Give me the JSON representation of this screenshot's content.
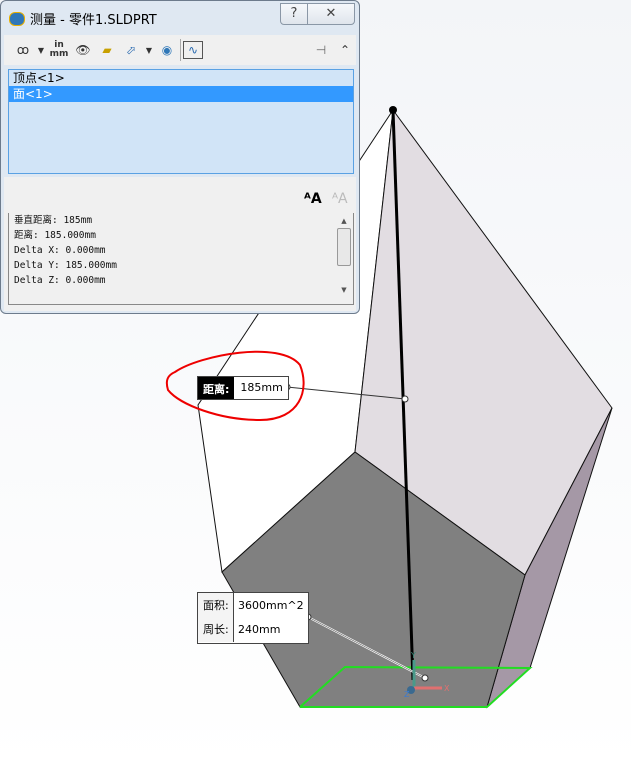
{
  "dialog": {
    "title": "测量 - 零件1.SLDPRT",
    "help": "?",
    "close": "✕",
    "toolbar": [
      "arc-circle-measure",
      "units-precision",
      "show-xyz",
      "point-to-point",
      "projection",
      "measurement-history",
      "create-sensor"
    ],
    "toolbar_labels": {
      "units_top": "in",
      "units_bottom": "mm"
    },
    "selections": [
      "顶点<1>",
      "面<1>"
    ],
    "results": [
      "垂直距离: 185mm",
      "距离: 185.000mm",
      "Delta X: 0.000mm",
      "Delta Y: 185.000mm",
      "Delta Z: 0.000mm"
    ]
  },
  "callout_distance": {
    "label": "距离:",
    "value": "185mm"
  },
  "callout_face": {
    "area_label": "面积:",
    "area_value": "3600mm^2",
    "perimeter_label": "周长:",
    "perimeter_value": "240mm"
  },
  "triad": {
    "x": "X",
    "y": "Y",
    "z": "Z"
  },
  "colors": {
    "highlight": "#3399ff",
    "selected_edge": "#22dd22",
    "annotation": "#ff0000"
  }
}
